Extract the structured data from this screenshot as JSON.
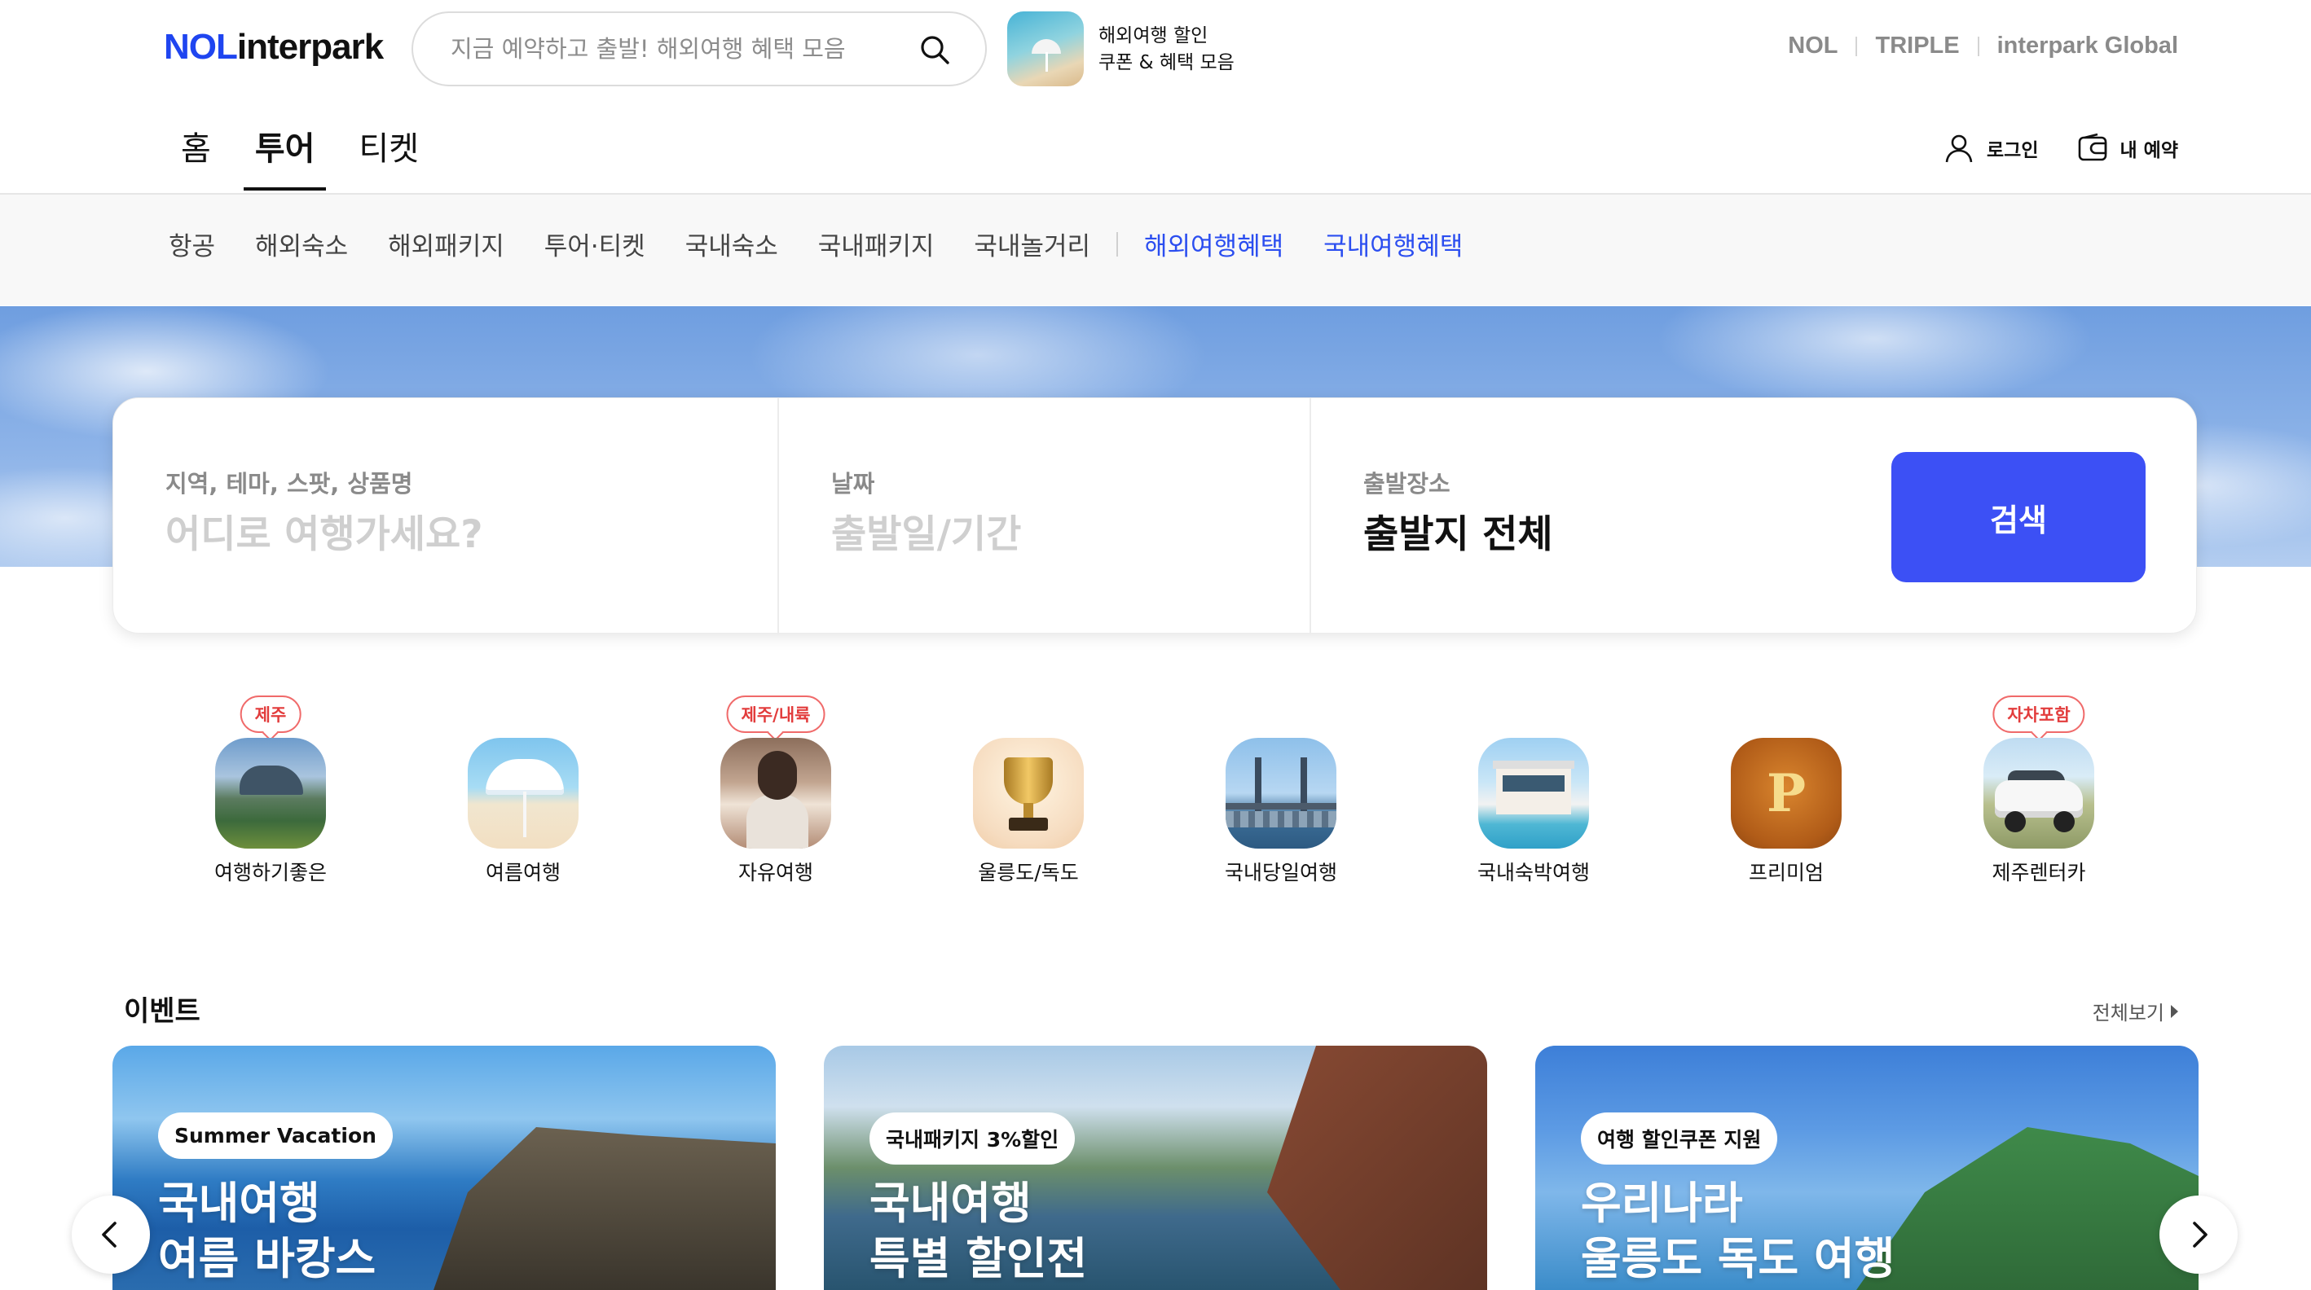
{
  "header": {
    "logo_nol": "NOL",
    "logo_interpark": "interpark",
    "search_placeholder": "지금 예약하고 출발! 해외여행 혜택 모음",
    "promo_line1": "해외여행 할인",
    "promo_line2": "쿠폰 & 혜택 모음",
    "brand_links": [
      "NOL",
      "TRIPLE",
      "interpark Global"
    ],
    "login_label": "로그인",
    "my_booking_label": "내 예약"
  },
  "main_tabs": [
    "홈",
    "투어",
    "티켓"
  ],
  "active_main_tab": "투어",
  "sub_nav": {
    "items": [
      "항공",
      "해외숙소",
      "해외패키지",
      "투어·티켓",
      "국내숙소",
      "국내패키지",
      "국내놀거리"
    ],
    "highlight_items": [
      "해외여행혜택",
      "국내여행혜택"
    ],
    "highlight_color": "#2b4ef0"
  },
  "search_card": {
    "keyword_label": "지역, 테마, 스팟, 상품명",
    "keyword_placeholder": "어디로 여행가세요?",
    "date_label": "날짜",
    "date_placeholder": "출발일/기간",
    "departure_label": "출발장소",
    "departure_value": "출발지 전체",
    "search_button": "검색",
    "button_color": "#3c50f5"
  },
  "categories": [
    {
      "label": "여행하기좋은",
      "badge": "제주",
      "icon": "jeju-landscape-icon"
    },
    {
      "label": "여름여행",
      "badge": "",
      "icon": "beach-umbrella-icon"
    },
    {
      "label": "자유여행",
      "badge": "제주/내륙",
      "icon": "traveler-icon"
    },
    {
      "label": "울릉도/독도",
      "badge": "",
      "icon": "trophy-icon"
    },
    {
      "label": "국내당일여행",
      "badge": "",
      "icon": "bridge-icon"
    },
    {
      "label": "국내숙박여행",
      "badge": "",
      "icon": "villa-icon"
    },
    {
      "label": "프리미엄",
      "badge": "",
      "icon": "premium-p-icon",
      "icon_letter": "P"
    },
    {
      "label": "제주렌터카",
      "badge": "자차포함",
      "icon": "rental-car-icon"
    }
  ],
  "events": {
    "title": "이벤트",
    "see_all": "전체보기",
    "cards": [
      {
        "chip": "Summer Vacation",
        "title_line1": "국내여행",
        "title_line2": "여름 바캉스"
      },
      {
        "chip": "국내패키지 3%할인",
        "title_line1": "국내여행",
        "title_line2": "특별 할인전"
      },
      {
        "chip": "여행 할인쿠폰 지원",
        "title_line1": "우리나라",
        "title_line2": "울릉도 독도 여행"
      }
    ]
  }
}
